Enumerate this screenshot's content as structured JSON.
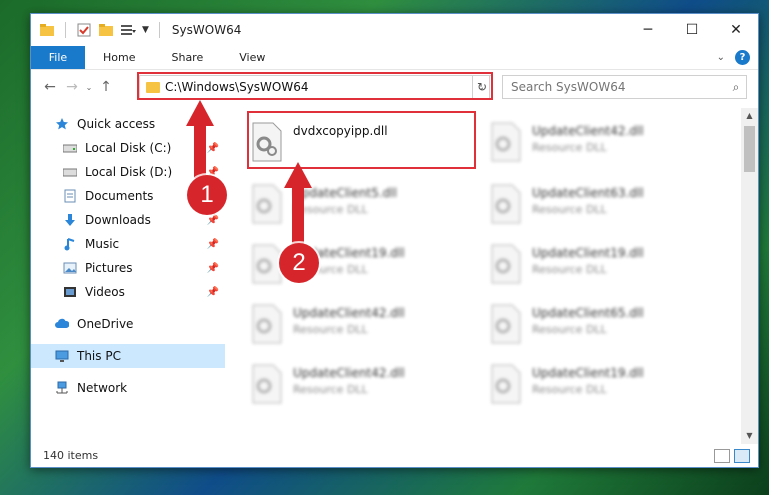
{
  "window": {
    "title": "SysWOW64"
  },
  "ribbon": {
    "file_tab": "File",
    "tabs": [
      "Home",
      "Share",
      "View"
    ]
  },
  "address": {
    "path": "C:\\Windows\\SysWOW64"
  },
  "search": {
    "placeholder": "Search SysWOW64"
  },
  "sidebar": {
    "quick_access": "Quick access",
    "items": [
      {
        "label": "Local Disk (C:)",
        "icon": "drive-icon",
        "pinned": true
      },
      {
        "label": "Local Disk (D:)",
        "icon": "drive-icon",
        "pinned": true
      },
      {
        "label": "Documents",
        "icon": "documents-icon",
        "pinned": true
      },
      {
        "label": "Downloads",
        "icon": "downloads-icon",
        "pinned": true
      },
      {
        "label": "Music",
        "icon": "music-icon",
        "pinned": true
      },
      {
        "label": "Pictures",
        "icon": "pictures-icon",
        "pinned": true
      },
      {
        "label": "Videos",
        "icon": "videos-icon",
        "pinned": true
      }
    ],
    "onedrive": "OneDrive",
    "this_pc": "This PC",
    "network": "Network"
  },
  "files": [
    {
      "name": "dvdxcopyipp.dll",
      "type": ""
    },
    {
      "name": "UpdateClient42.dll",
      "type": "Resource DLL"
    },
    {
      "name": "UpdateClient5.dll",
      "type": "Resource DLL"
    },
    {
      "name": "UpdateClient63.dll",
      "type": "Resource DLL"
    },
    {
      "name": "UpdateClient19.dll",
      "type": "Resource DLL"
    },
    {
      "name": "UpdateClient19.dll",
      "type": "Resource DLL"
    },
    {
      "name": "UpdateClient42.dll",
      "type": "Resource DLL"
    },
    {
      "name": "UpdateClient65.dll",
      "type": "Resource DLL"
    },
    {
      "name": "UpdateClient42.dll",
      "type": "Resource DLL"
    },
    {
      "name": "UpdateClient19.dll",
      "type": "Resource DLL"
    }
  ],
  "status": {
    "items_count": "140 items"
  },
  "callouts": [
    "1",
    "2"
  ],
  "colors": {
    "accent": "#1979ca",
    "highlight": "#e0303a",
    "callout": "#d7262b",
    "selected": "#cce8ff"
  }
}
